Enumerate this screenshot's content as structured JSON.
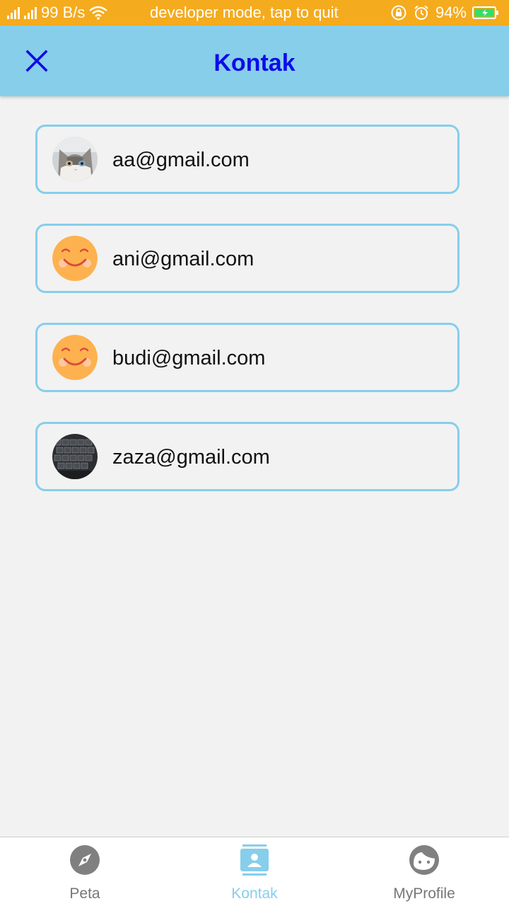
{
  "status_bar": {
    "network_speed": "99 B/s",
    "developer_notice": "developer mode, tap to quit",
    "battery_percent": "94%",
    "background_color": "#f5ab1e"
  },
  "app_bar": {
    "title": "Kontak",
    "close_icon": "close-icon",
    "background_color": "#87ceeb",
    "title_color": "#0d0de6"
  },
  "contacts": [
    {
      "email": "aa@gmail.com",
      "avatar": "cat-photo"
    },
    {
      "email": "ani@gmail.com",
      "avatar": "smiley-emoji"
    },
    {
      "email": "budi@gmail.com",
      "avatar": "smiley-emoji"
    },
    {
      "email": "zaza@gmail.com",
      "avatar": "keyboard-photo"
    }
  ],
  "bottom_nav": {
    "items": [
      {
        "label": "Peta",
        "icon": "compass-icon",
        "active": false
      },
      {
        "label": "Kontak",
        "icon": "contact-card-icon",
        "active": true
      },
      {
        "label": "MyProfile",
        "icon": "face-icon",
        "active": false
      }
    ],
    "active_color": "#87ceeb",
    "inactive_color": "#777777"
  }
}
